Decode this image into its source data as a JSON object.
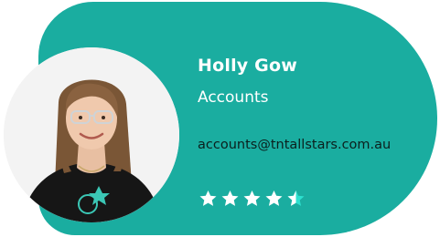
{
  "profile": {
    "name": "Holly Gow",
    "role": "Accounts",
    "email": "accounts@tntallstars.com.au",
    "rating": 4.5,
    "rating_max": 5
  },
  "colors": {
    "card": "#1aada0",
    "text_primary": "#ffffff",
    "text_email": "#0b1f1d",
    "star_filled": "#ffffff",
    "star_empty": "#2de0cf"
  },
  "icons": {
    "rating": "star-icon"
  }
}
